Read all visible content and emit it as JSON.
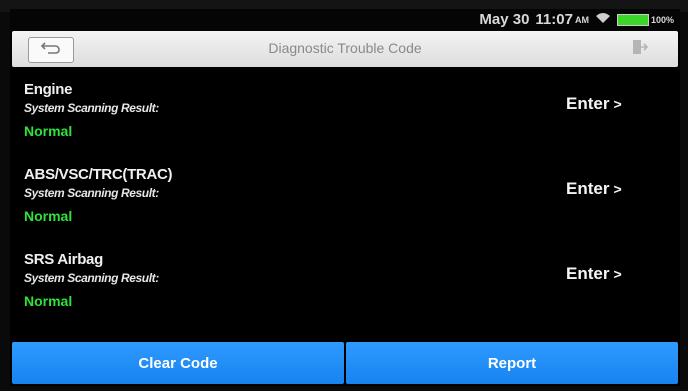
{
  "status_bar": {
    "date": "May 30",
    "time": "11:07",
    "ampm": "AM",
    "battery_level": "100%",
    "icons": [
      "wifi-icon",
      "battery-icon"
    ]
  },
  "header": {
    "title": "Diagnostic Trouble Code",
    "icons": [
      "back-arrow-icon",
      "exit-icon"
    ]
  },
  "systems": [
    {
      "name": "Engine",
      "result_label": "System Scanning Result:",
      "status": "Normal",
      "action": "Enter",
      "action_icon": "chevron-right-icon"
    },
    {
      "name": "ABS/VSC/TRC(TRAC)",
      "result_label": "System Scanning Result:",
      "status": "Normal",
      "action": "Enter",
      "action_icon": "chevron-right-icon"
    },
    {
      "name": "SRS Airbag",
      "result_label": "System Scanning Result:",
      "status": "Normal",
      "action": "Enter",
      "action_icon": "chevron-right-icon"
    }
  ],
  "footer": {
    "clear_label": "Clear Code",
    "report_label": "Report"
  },
  "colors": {
    "status_normal": "#2fe23a",
    "button_blue": "#1f8cf7",
    "header_bg": "#e8e8e8",
    "battery_green": "#3ad62a"
  }
}
